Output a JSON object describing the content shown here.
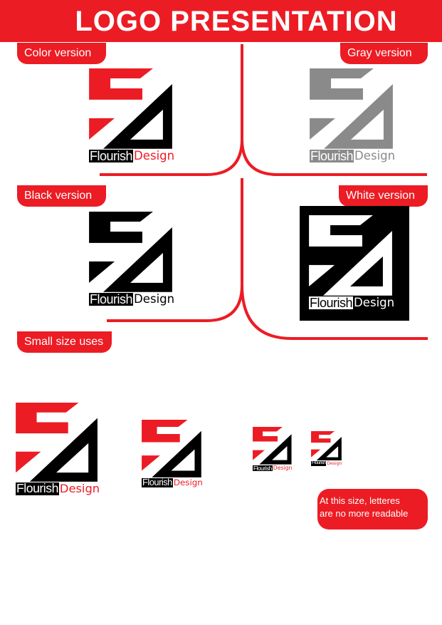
{
  "header": {
    "title": "LOGO PRESENTATION"
  },
  "labels": {
    "color_version": "Color version",
    "gray_version": "Gray version",
    "black_version": "Black version",
    "white_version": "White version",
    "small_size_uses": "Small size uses"
  },
  "note": {
    "line1": "At this size, letteres",
    "line2": "are no more readable"
  },
  "wordmark": {
    "part1": "Flourish",
    "part2": "Design"
  },
  "colors": {
    "accent_red": "#ec1c24",
    "black": "#000000",
    "gray": "#8a8a8a",
    "white": "#ffffff"
  },
  "variants": {
    "color": {
      "mark_top": "#ec1c24",
      "mark_bottom": "#000000",
      "flourish_bg": "#000000",
      "flourish_text": "#ffffff",
      "design_text": "#ec1c24"
    },
    "gray": {
      "mark_top": "#8a8a8a",
      "mark_bottom": "#8a8a8a",
      "flourish_bg": "#8a8a8a",
      "flourish_text": "#ffffff",
      "design_text": "#8a8a8a"
    },
    "black": {
      "mark_top": "#000000",
      "mark_bottom": "#000000",
      "flourish_bg": "#000000",
      "flourish_text": "#ffffff",
      "design_text": "#000000"
    },
    "white": {
      "mark_top": "#ffffff",
      "mark_bottom": "#ffffff",
      "flourish_bg": "#ffffff",
      "flourish_text": "#000000",
      "design_text": "#ffffff"
    }
  }
}
